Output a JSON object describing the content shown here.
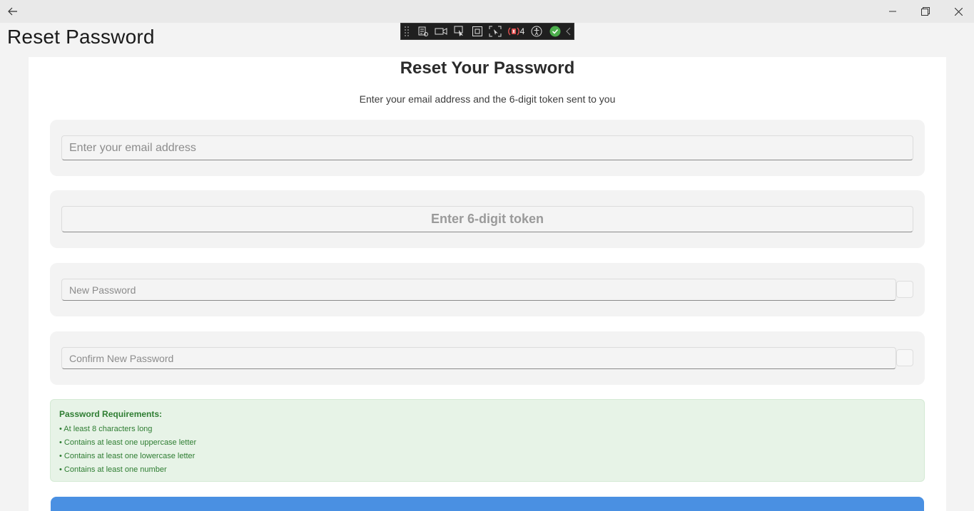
{
  "window": {
    "back_icon": "back-arrow-icon",
    "controls": [
      "minimize-icon",
      "maximize-icon",
      "close-icon"
    ]
  },
  "header": {
    "title": "Reset Password"
  },
  "debug_toolbar": {
    "error_count": "4"
  },
  "form": {
    "heading": "Reset Your Password",
    "subheading": "Enter your email address and the 6-digit token sent to you",
    "email_placeholder": "Enter your email address",
    "token_placeholder": "Enter 6-digit token",
    "new_password_placeholder": "New Password",
    "confirm_password_placeholder": "Confirm New Password"
  },
  "requirements": {
    "title": "Password Requirements:",
    "items": [
      "• At least 8 characters long",
      "• Contains at least one uppercase letter",
      "• Contains at least one lowercase letter",
      "• Contains at least one number"
    ]
  },
  "colors": {
    "accent": "#4a90e2",
    "success_text": "#2e7d32",
    "success_bg": "#e7f3e7"
  }
}
